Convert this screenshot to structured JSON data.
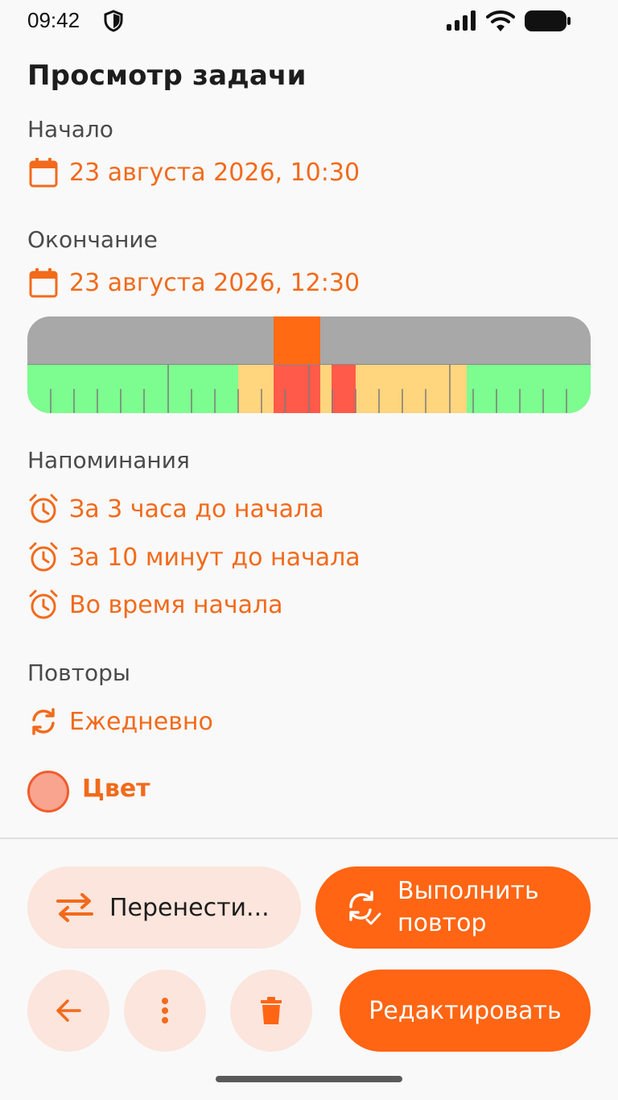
{
  "status_bar": {
    "time": "09:42",
    "icons": [
      "shield-icon",
      "signal-icon",
      "wifi-icon",
      "battery-icon"
    ]
  },
  "page": {
    "title": "Просмотр задачи"
  },
  "start": {
    "label": "Начало",
    "value": "23 августа 2026, 10:30",
    "icon": "calendar-icon"
  },
  "end": {
    "label": "Окончание",
    "value": "23 августа 2026, 12:30",
    "icon": "calendar-icon"
  },
  "reminders": {
    "label": "Напоминания",
    "items": [
      {
        "text": "За 3 часа до начала",
        "icon": "alarm-icon"
      },
      {
        "text": "За 10 минут до начала",
        "icon": "alarm-icon"
      },
      {
        "text": "Во время начала",
        "icon": "alarm-icon"
      }
    ]
  },
  "repeats": {
    "label": "Повторы",
    "value": "Ежедневно",
    "icon": "repeat-icon"
  },
  "color": {
    "label": "Цвет",
    "swatch": "#f8a48e",
    "border": "#f05c2c"
  },
  "actions": {
    "postpone_label": "Перенести...",
    "repeat_label_line1": "Выполнить",
    "repeat_label_line2": "повтор",
    "edit_label": "Редактировать",
    "back_icon": "arrow-left-icon",
    "more_icon": "more-vertical-icon",
    "delete_icon": "trash-icon"
  },
  "colors": {
    "accent": "#ff6513",
    "accent_text": "#f26a1b",
    "soft_bg": "#fbe5dc",
    "timeline_free": "#7dfc8f",
    "timeline_busy": "#ffd57d",
    "timeline_conflict": "#ff5a4a",
    "timeline_bg": "#a8a8a8"
  }
}
